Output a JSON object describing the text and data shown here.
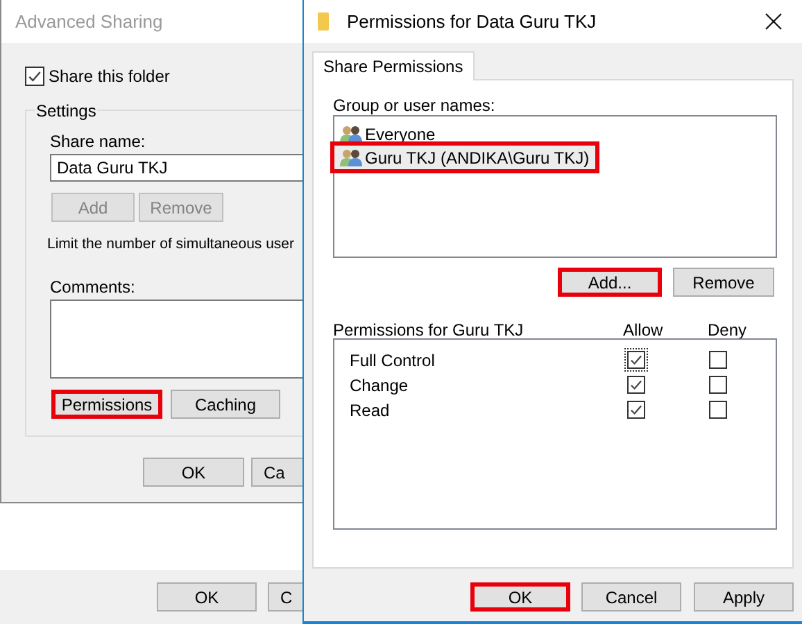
{
  "properties_window": {
    "buttons": [
      {
        "label": "OK"
      },
      {
        "label": "C"
      }
    ]
  },
  "advanced_sharing": {
    "title": "Advanced Sharing",
    "share_checkbox": {
      "label": "Share this folder",
      "checked": true
    },
    "settings": {
      "title": "Settings",
      "share_name_label": "Share name:",
      "share_name": "Data Guru TKJ",
      "name_buttons": [
        {
          "label": "Add",
          "disabled": true
        },
        {
          "label": "Remove",
          "disabled": true
        }
      ],
      "limit_text": "Limit the number of simultaneous user",
      "comments_label": "Comments:",
      "buttons": [
        {
          "label": "Permissions",
          "highlighted": true
        },
        {
          "label": "Caching",
          "highlighted": false
        }
      ]
    },
    "buttons": [
      {
        "label": "OK"
      },
      {
        "label": "Ca"
      }
    ]
  },
  "permissions_window": {
    "title": "Permissions for Data Guru TKJ",
    "tabs": [
      {
        "label": "Share Permissions",
        "selected": true
      }
    ],
    "group_label": "Group or user names:",
    "users": [
      {
        "name": "Everyone",
        "selected": false,
        "highlighted": false
      },
      {
        "name": "Guru TKJ (ANDIKA\\Guru TKJ)",
        "selected": true,
        "highlighted": true
      }
    ],
    "user_buttons": [
      {
        "label": "Add...",
        "highlighted": true
      },
      {
        "label": "Remove",
        "highlighted": false
      }
    ],
    "permissions_label": "Permissions for Guru TKJ",
    "allow_label": "Allow",
    "deny_label": "Deny",
    "permissions": [
      {
        "name": "Full Control",
        "allow": true,
        "deny": false,
        "focused": true
      },
      {
        "name": "Change",
        "allow": true,
        "deny": false,
        "focused": false
      },
      {
        "name": "Read",
        "allow": true,
        "deny": false,
        "focused": false
      }
    ],
    "buttons": [
      {
        "label": "OK",
        "highlighted": true
      },
      {
        "label": "Cancel",
        "highlighted": false
      },
      {
        "label": "Apply",
        "highlighted": false
      }
    ]
  }
}
